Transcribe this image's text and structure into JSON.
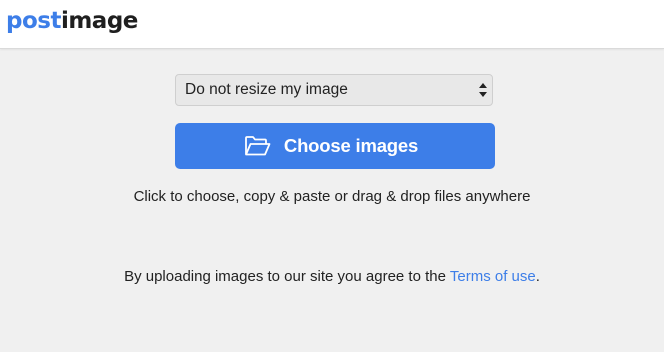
{
  "header": {
    "logo_part1": "post",
    "logo_part2": "image"
  },
  "upload": {
    "resize_select": {
      "selected": "Do not resize my image",
      "icon": "updown-arrows-icon"
    },
    "choose_button": {
      "label": "Choose images",
      "icon": "folder-open-icon"
    },
    "hint": "Click to choose, copy & paste or drag & drop files anywhere",
    "terms_prefix": "By uploading images to our site you agree to the ",
    "terms_link": "Terms of use",
    "terms_suffix": "."
  },
  "colors": {
    "brand_blue": "#3d7ee8",
    "background": "#f0f0f0",
    "header_background": "#ffffff",
    "text": "#222222"
  }
}
